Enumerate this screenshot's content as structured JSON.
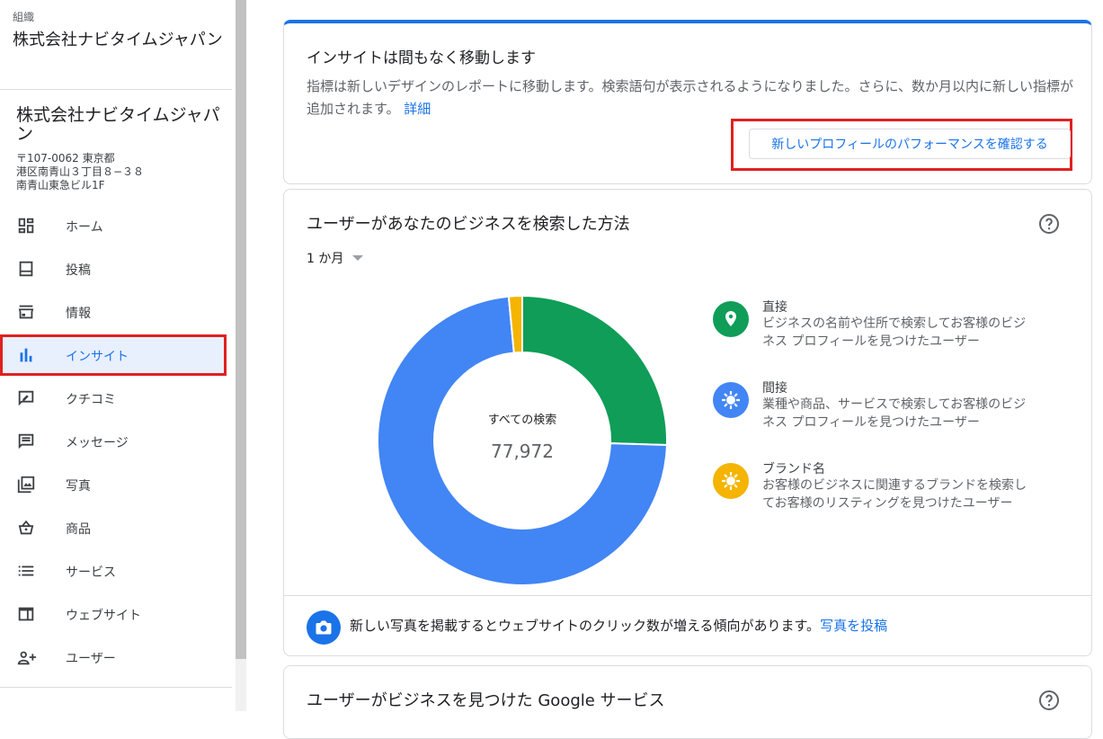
{
  "sidebar": {
    "org_label": "組織",
    "org_name": "株式会社ナビタイムジャパン",
    "business_name": "株式会社ナビタイムジャパン",
    "address": [
      "〒107-0062 東京都",
      "港区南青山３丁目８−３８",
      "南青山東急ビル1F"
    ],
    "items": [
      {
        "label": "ホーム",
        "icon": "dashboard-icon"
      },
      {
        "label": "投稿",
        "icon": "posts-icon"
      },
      {
        "label": "情報",
        "icon": "storefront-icon"
      },
      {
        "label": "インサイト",
        "icon": "insights-bar-chart-icon",
        "active": true
      },
      {
        "label": "クチコミ",
        "icon": "reviews-icon"
      },
      {
        "label": "メッセージ",
        "icon": "messages-icon"
      },
      {
        "label": "写真",
        "icon": "photos-icon"
      },
      {
        "label": "商品",
        "icon": "products-basket-icon"
      },
      {
        "label": "サービス",
        "icon": "services-list-icon"
      },
      {
        "label": "ウェブサイト",
        "icon": "website-icon"
      },
      {
        "label": "ユーザー",
        "icon": "add-user-icon"
      }
    ]
  },
  "notice": {
    "title": "インサイトは間もなく移動します",
    "body": "指標は新しいデザインのレポートに移動します。検索語句が表示されるようになりました。さらに、数か月以内に新しい指標が追加されます。",
    "details_link": "詳細",
    "button_label": "新しいプロフィールのパフォーマンスを確認する"
  },
  "search_card": {
    "title": "ユーザーがあなたのビジネスを検索した方法",
    "range_label": "1 か月",
    "center_label": "すべての検索",
    "total": "77,972",
    "legend": [
      {
        "title": "直接",
        "desc": "ビジネスの名前や住所で検索してお客様のビジネス プロフィールを見つけたユーザー",
        "icon": "location-pin-icon"
      },
      {
        "title": "間接",
        "desc": "業種や商品、サービスで検索してお客様のビジネス プロフィールを見つけたユーザー",
        "icon": "discovery-icon"
      },
      {
        "title": "ブランド名",
        "desc": "お客様のビジネスに関連するブランドを検索してお客様のリスティングを見つけたユーザー",
        "icon": "brand-icon"
      }
    ],
    "tip_text": "新しい写真を掲載するとウェブサイトのクリック数が増える傾向があります。",
    "tip_link": "写真を投稿"
  },
  "google_card": {
    "title": "ユーザーがビジネスを見つけた Google サービス"
  },
  "chart_data": {
    "type": "pie",
    "categories": [
      "直接",
      "間接",
      "ブランド名"
    ],
    "values": [
      25.5,
      73.0,
      1.5
    ],
    "colors": [
      "#0f9d58",
      "#4285f4",
      "#f4b400"
    ],
    "start_angle_deg": 0,
    "direction": "clockwise"
  },
  "colors": {
    "accent": "#1a73e8",
    "highlight_frame": "#e02020",
    "direct": "#0f9d58",
    "indirect": "#4285f4",
    "brand": "#f4b400"
  }
}
